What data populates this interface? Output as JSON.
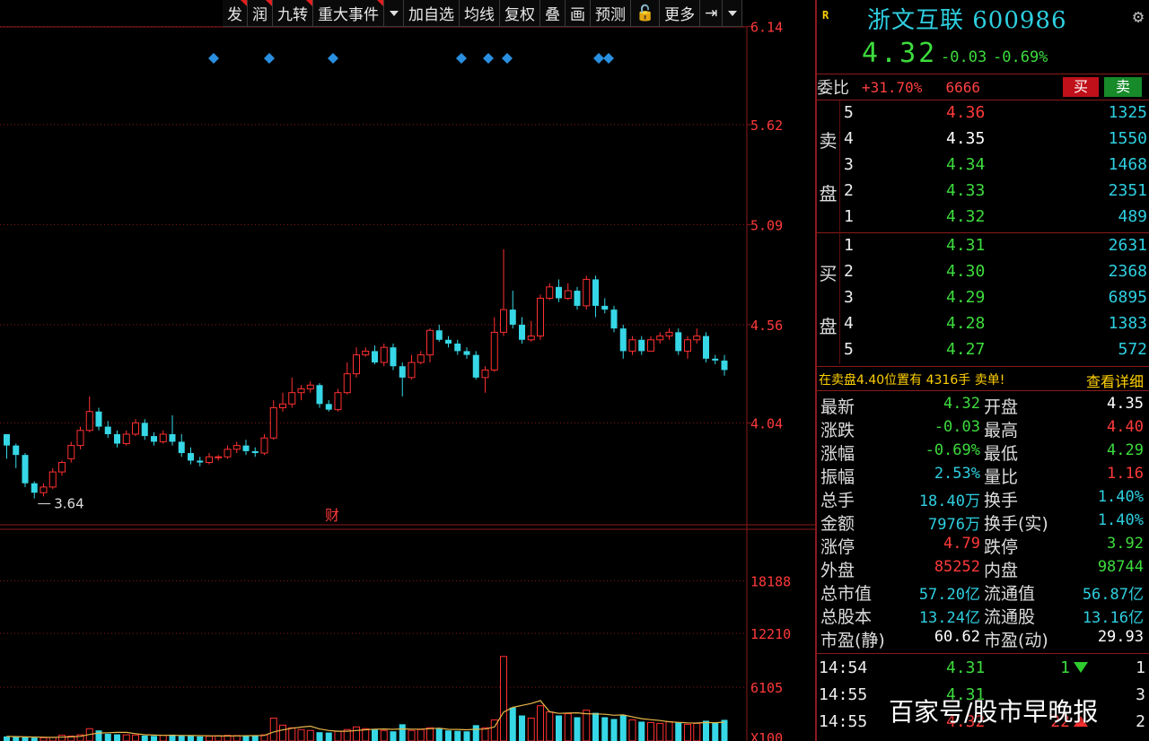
{
  "toolbar": {
    "buttons": [
      "发",
      "润",
      "九转",
      "重大事件",
      "加自选",
      "均线",
      "复权",
      "叠",
      "画",
      "预测",
      "🔓",
      "更多",
      "⇥"
    ]
  },
  "chart_data": {
    "type": "candlestick",
    "price_axis_ticks": [
      "6.14",
      "5.62",
      "5.09",
      "4.56",
      "4.04"
    ],
    "volume_axis_ticks": [
      "18188",
      "12210",
      "6105",
      "X100"
    ],
    "low_label": "3.64",
    "event_marker": "财",
    "price_range": [
      3.5,
      6.28
    ],
    "volume_max": 22000,
    "candles": [
      [
        3.98,
        3.92,
        3.94,
        3.85
      ],
      [
        3.92,
        3.87,
        3.93,
        3.8
      ],
      [
        3.87,
        3.72,
        3.88,
        3.7
      ],
      [
        3.72,
        3.67,
        3.73,
        3.64
      ],
      [
        3.67,
        3.7,
        3.72,
        3.65
      ],
      [
        3.7,
        3.78,
        3.8,
        3.69
      ],
      [
        3.78,
        3.83,
        3.84,
        3.76
      ],
      [
        3.85,
        3.92,
        3.94,
        3.83
      ],
      [
        3.92,
        4.0,
        4.02,
        3.9
      ],
      [
        4.0,
        4.1,
        4.18,
        3.99
      ],
      [
        4.1,
        4.02,
        4.12,
        4.0
      ],
      [
        4.02,
        3.98,
        4.05,
        3.96
      ],
      [
        3.98,
        3.93,
        4.0,
        3.91
      ],
      [
        3.93,
        3.98,
        4.0,
        3.92
      ],
      [
        3.98,
        4.04,
        4.06,
        3.97
      ],
      [
        4.04,
        3.97,
        4.06,
        3.95
      ],
      [
        3.97,
        3.94,
        3.99,
        3.92
      ],
      [
        3.94,
        3.98,
        4.0,
        3.93
      ],
      [
        3.98,
        3.94,
        4.08,
        3.92
      ],
      [
        3.94,
        3.88,
        3.98,
        3.86
      ],
      [
        3.88,
        3.84,
        3.91,
        3.82
      ],
      [
        3.84,
        3.83,
        3.86,
        3.81
      ],
      [
        3.83,
        3.86,
        3.88,
        3.82
      ],
      [
        3.86,
        3.86,
        3.87,
        3.84
      ],
      [
        3.86,
        3.9,
        3.92,
        3.85
      ],
      [
        3.9,
        3.92,
        3.94,
        3.88
      ],
      [
        3.92,
        3.89,
        3.95,
        3.87
      ],
      [
        3.89,
        3.88,
        3.91,
        3.86
      ],
      [
        3.88,
        3.96,
        3.98,
        3.87
      ],
      [
        3.96,
        4.12,
        4.16,
        3.95
      ],
      [
        4.12,
        4.14,
        4.2,
        4.1
      ],
      [
        4.14,
        4.2,
        4.28,
        4.12
      ],
      [
        4.2,
        4.22,
        4.24,
        4.16
      ],
      [
        4.22,
        4.24,
        4.26,
        4.2
      ],
      [
        4.24,
        4.14,
        4.25,
        4.12
      ],
      [
        4.14,
        4.11,
        4.16,
        4.1
      ],
      [
        4.11,
        4.2,
        4.22,
        4.1
      ],
      [
        4.2,
        4.3,
        4.36,
        4.19
      ],
      [
        4.3,
        4.4,
        4.44,
        4.28
      ],
      [
        4.4,
        4.42,
        4.44,
        4.39
      ],
      [
        4.42,
        4.36,
        4.45,
        4.35
      ],
      [
        4.36,
        4.44,
        4.46,
        4.34
      ],
      [
        4.44,
        4.34,
        4.46,
        4.32
      ],
      [
        4.34,
        4.28,
        4.36,
        4.18
      ],
      [
        4.28,
        4.36,
        4.4,
        4.27
      ],
      [
        4.36,
        4.4,
        4.42,
        4.35
      ],
      [
        4.4,
        4.53,
        4.54,
        4.36
      ],
      [
        4.53,
        4.48,
        4.56,
        4.47
      ],
      [
        4.48,
        4.46,
        4.5,
        4.44
      ],
      [
        4.46,
        4.42,
        4.48,
        4.4
      ],
      [
        4.42,
        4.4,
        4.44,
        4.38
      ],
      [
        4.4,
        4.28,
        4.42,
        4.27
      ],
      [
        4.28,
        4.32,
        4.34,
        4.2
      ],
      [
        4.32,
        4.52,
        4.6,
        4.31
      ],
      [
        4.52,
        4.64,
        4.96,
        4.5
      ],
      [
        4.64,
        4.56,
        4.74,
        4.54
      ],
      [
        4.56,
        4.48,
        4.6,
        4.46
      ],
      [
        4.48,
        4.5,
        4.58,
        4.47
      ],
      [
        4.5,
        4.7,
        4.72,
        4.48
      ],
      [
        4.7,
        4.76,
        4.78,
        4.69
      ],
      [
        4.76,
        4.7,
        4.8,
        4.68
      ],
      [
        4.7,
        4.74,
        4.78,
        4.69
      ],
      [
        4.74,
        4.66,
        4.76,
        4.64
      ],
      [
        4.66,
        4.8,
        4.82,
        4.64
      ],
      [
        4.8,
        4.66,
        4.82,
        4.6
      ],
      [
        4.66,
        4.64,
        4.7,
        4.62
      ],
      [
        4.64,
        4.54,
        4.66,
        4.52
      ],
      [
        4.54,
        4.42,
        4.56,
        4.38
      ],
      [
        4.42,
        4.48,
        4.5,
        4.4
      ],
      [
        4.48,
        4.42,
        4.5,
        4.4
      ],
      [
        4.42,
        4.48,
        4.5,
        4.42
      ],
      [
        4.48,
        4.5,
        4.52,
        4.46
      ],
      [
        4.5,
        4.52,
        4.54,
        4.48
      ],
      [
        4.52,
        4.42,
        4.54,
        4.4
      ],
      [
        4.42,
        4.48,
        4.5,
        4.38
      ],
      [
        4.48,
        4.5,
        4.54,
        4.46
      ],
      [
        4.5,
        4.38,
        4.52,
        4.36
      ],
      [
        4.38,
        4.37,
        4.4,
        4.35
      ],
      [
        4.37,
        4.32,
        4.4,
        4.29
      ]
    ],
    "volumes": [
      520,
      480,
      410,
      380,
      360,
      400,
      650,
      560,
      700,
      1400,
      1200,
      820,
      760,
      700,
      680,
      620,
      580,
      640,
      720,
      610,
      560,
      520,
      540,
      600,
      640,
      620,
      590,
      610,
      700,
      2600,
      1800,
      1500,
      1300,
      1200,
      1000,
      960,
      1100,
      1300,
      1600,
      1400,
      1300,
      1200,
      1100,
      1900,
      1200,
      1300,
      1500,
      1400,
      1200,
      1150,
      1100,
      1800,
      1500,
      2400,
      9600,
      3800,
      2900,
      2600,
      4000,
      3300,
      2900,
      3100,
      2700,
      3500,
      3200,
      2700,
      2500,
      2900,
      2400,
      2200,
      2100,
      2000,
      2200,
      2100,
      1900,
      2000,
      2300,
      2100,
      2400
    ]
  },
  "quote": {
    "badge": "R",
    "name": "浙文互联 600986",
    "price": "4.32",
    "change": "-0.03",
    "change_pct": "-0.69%",
    "wb_label": "委比",
    "wb_pct": "+31.70%",
    "wb_diff": "6666",
    "buy_label": "买",
    "sell_label": "卖"
  },
  "sell_book": {
    "side_chars": [
      "卖",
      "盘"
    ],
    "rows": [
      {
        "lvl": "5",
        "price": "4.36",
        "vol": "1325",
        "color": "red"
      },
      {
        "lvl": "4",
        "price": "4.35",
        "vol": "1550",
        "color": "white"
      },
      {
        "lvl": "3",
        "price": "4.34",
        "vol": "1468",
        "color": "green"
      },
      {
        "lvl": "2",
        "price": "4.33",
        "vol": "2351",
        "color": "green"
      },
      {
        "lvl": "1",
        "price": "4.32",
        "vol": "489",
        "color": "green"
      }
    ]
  },
  "buy_book": {
    "side_chars": [
      "买",
      "盘"
    ],
    "rows": [
      {
        "lvl": "1",
        "price": "4.31",
        "vol": "2631",
        "color": "green"
      },
      {
        "lvl": "2",
        "price": "4.30",
        "vol": "2368",
        "color": "green"
      },
      {
        "lvl": "3",
        "price": "4.29",
        "vol": "6895",
        "color": "green"
      },
      {
        "lvl": "4",
        "price": "4.28",
        "vol": "1383",
        "color": "green"
      },
      {
        "lvl": "5",
        "price": "4.27",
        "vol": "572",
        "color": "green"
      }
    ]
  },
  "hint": {
    "text": "在卖盘4.40位置有 4316手 卖单!",
    "link": "查看详细"
  },
  "stats": [
    {
      "l1": "最新",
      "v1": "4.32",
      "c1": "green",
      "l2": "开盘",
      "v2": "4.35",
      "c2": "white"
    },
    {
      "l1": "涨跌",
      "v1": "-0.03",
      "c1": "green",
      "l2": "最高",
      "v2": "4.40",
      "c2": "red"
    },
    {
      "l1": "涨幅",
      "v1": "-0.69%",
      "c1": "green",
      "l2": "最低",
      "v2": "4.29",
      "c2": "green"
    },
    {
      "l1": "振幅",
      "v1": "2.53%",
      "c1": "cyan",
      "l2": "量比",
      "v2": "1.16",
      "c2": "red"
    },
    {
      "l1": "总手",
      "v1": "18.40万",
      "c1": "cyan",
      "l2": "换手",
      "v2": "1.40%",
      "c2": "cyan"
    },
    {
      "l1": "金额",
      "v1": "7976万",
      "c1": "cyan",
      "l2": "换手(实)",
      "v2": "1.40%",
      "c2": "cyan"
    },
    {
      "l1": "涨停",
      "v1": "4.79",
      "c1": "red",
      "l2": "跌停",
      "v2": "3.92",
      "c2": "green"
    },
    {
      "l1": "外盘",
      "v1": "85252",
      "c1": "red",
      "l2": "内盘",
      "v2": "98744",
      "c2": "green"
    },
    {
      "l1": "总市值",
      "v1": "57.20亿",
      "c1": "cyan",
      "l2": "流通值",
      "v2": "56.87亿",
      "c2": "cyan"
    },
    {
      "l1": "总股本",
      "v1": "13.24亿",
      "c1": "cyan",
      "l2": "流通股",
      "v2": "13.16亿",
      "c2": "cyan"
    },
    {
      "l1": "市盈(静)",
      "v1": "60.62",
      "c1": "white",
      "l2": "市盈(动)",
      "v2": "29.93",
      "c2": "white"
    }
  ],
  "ticks": [
    {
      "time": "14:54",
      "price": "4.31",
      "vol": "1",
      "dir": "down",
      "n": "1"
    },
    {
      "time": "14:55",
      "price": "4.31",
      "vol": "",
      "dir": "",
      "n": "3"
    },
    {
      "time": "14:55",
      "price": "4.32",
      "vol": "22",
      "dir": "up",
      "n": "2"
    }
  ],
  "watermark": "百家号/股市早晚报",
  "colors": {
    "up": "#ff3030",
    "down": "#36d7e6",
    "grid": "#8b1a1a",
    "ma": "#e8b84a"
  }
}
